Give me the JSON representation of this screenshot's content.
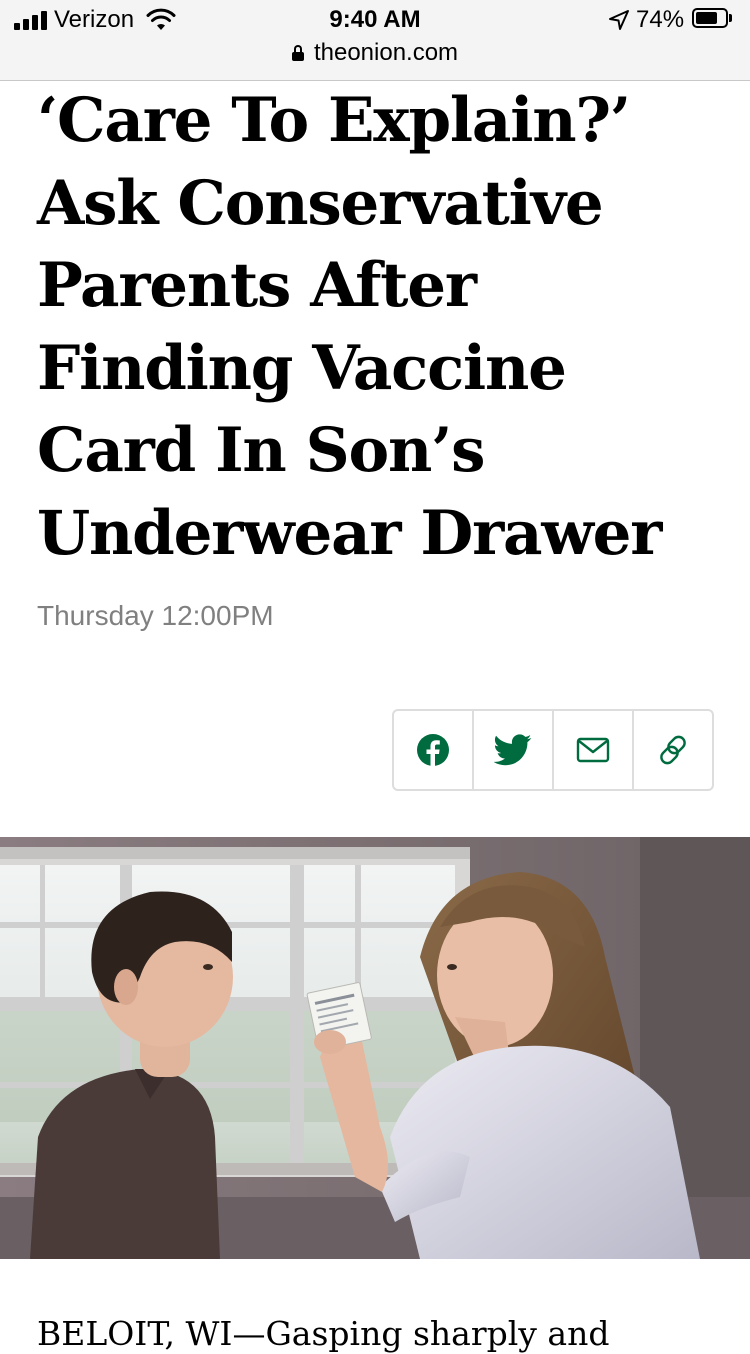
{
  "status_bar": {
    "carrier": "Verizon",
    "time": "9:40 AM",
    "battery_percent": "74%",
    "battery_level": 0.74,
    "signal_bars": 4,
    "icons": [
      "signal-icon",
      "wifi-icon",
      "location-arrow-icon",
      "battery-icon"
    ]
  },
  "browser": {
    "url": "theonion.com",
    "secure_icon": "lock-icon"
  },
  "article": {
    "headline": "‘Care To Explain?’ Ask Conservative Parents After Finding Vaccine Card In Son’s Underwear Drawer",
    "dateline": "Thursday 12:00PM",
    "lede_visible": "BELOIT, WI—Gasping sharply and"
  },
  "share": {
    "buttons": [
      {
        "icon": "facebook-icon",
        "color": "#006b3f"
      },
      {
        "icon": "twitter-icon",
        "color": "#006b3f"
      },
      {
        "icon": "email-icon",
        "color": "#006b3f"
      },
      {
        "icon": "link-icon",
        "color": "#006b3f"
      }
    ]
  },
  "colors": {
    "accent": "#006b3f",
    "dateline": "#808080",
    "status_bar_bg": "#f4f4f4"
  }
}
